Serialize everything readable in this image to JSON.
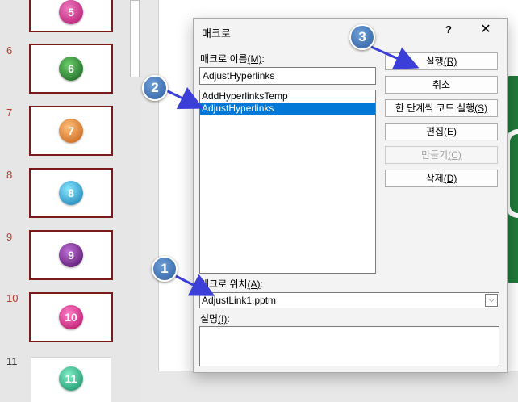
{
  "thumbnails": [
    {
      "number": "",
      "label": "5",
      "color": "#c0187a",
      "active_border": true
    },
    {
      "number": "6",
      "label": "6",
      "color": "#1e7a2a",
      "active_border": true
    },
    {
      "number": "7",
      "label": "7",
      "color": "#e07a20",
      "active_border": true
    },
    {
      "number": "8",
      "label": "8",
      "color": "#1aa6d6",
      "active_border": true
    },
    {
      "number": "9",
      "label": "9",
      "color": "#6a1a80",
      "active_border": true
    },
    {
      "number": "10",
      "label": "10",
      "color": "#d01a7a",
      "active_border": true
    },
    {
      "number": "11",
      "label": "11",
      "color": "#22a88a",
      "active_border": false
    }
  ],
  "dialog": {
    "title": "매크로",
    "help": "?",
    "close": "✕",
    "name_label": "매크로 이름",
    "name_mnemonic": "(M)",
    "name_label_suffix": ":",
    "name_value": "AdjustHyperlinks",
    "macro_list": [
      "AddHyperlinksTemp",
      "AdjustHyperlinks"
    ],
    "selected_index": 1,
    "buttons": {
      "run": {
        "text": "실행",
        "key": "(R)"
      },
      "cancel": {
        "text": "취소",
        "key": ""
      },
      "step": {
        "text": "한 단계씩 코드 실행",
        "key": "(S)"
      },
      "edit": {
        "text": "편집",
        "key": "(E)"
      },
      "create": {
        "text": "만들기",
        "key": "(C)"
      },
      "delete": {
        "text": "삭제",
        "key": "(D)"
      }
    },
    "location_label": "매크로 위치",
    "location_mnemonic": "(A)",
    "location_value": "AdjustLink1.pptm",
    "description_label": "설명",
    "description_mnemonic": "(I)",
    "description_value": ""
  },
  "callouts": [
    "1",
    "2",
    "3"
  ],
  "colors": {
    "selection": "#0078d7",
    "callout": "#3a6db0",
    "arrow": "#3b3fd8",
    "slide_number": "#c0392b",
    "thumb_border": "#7a1a1a"
  }
}
